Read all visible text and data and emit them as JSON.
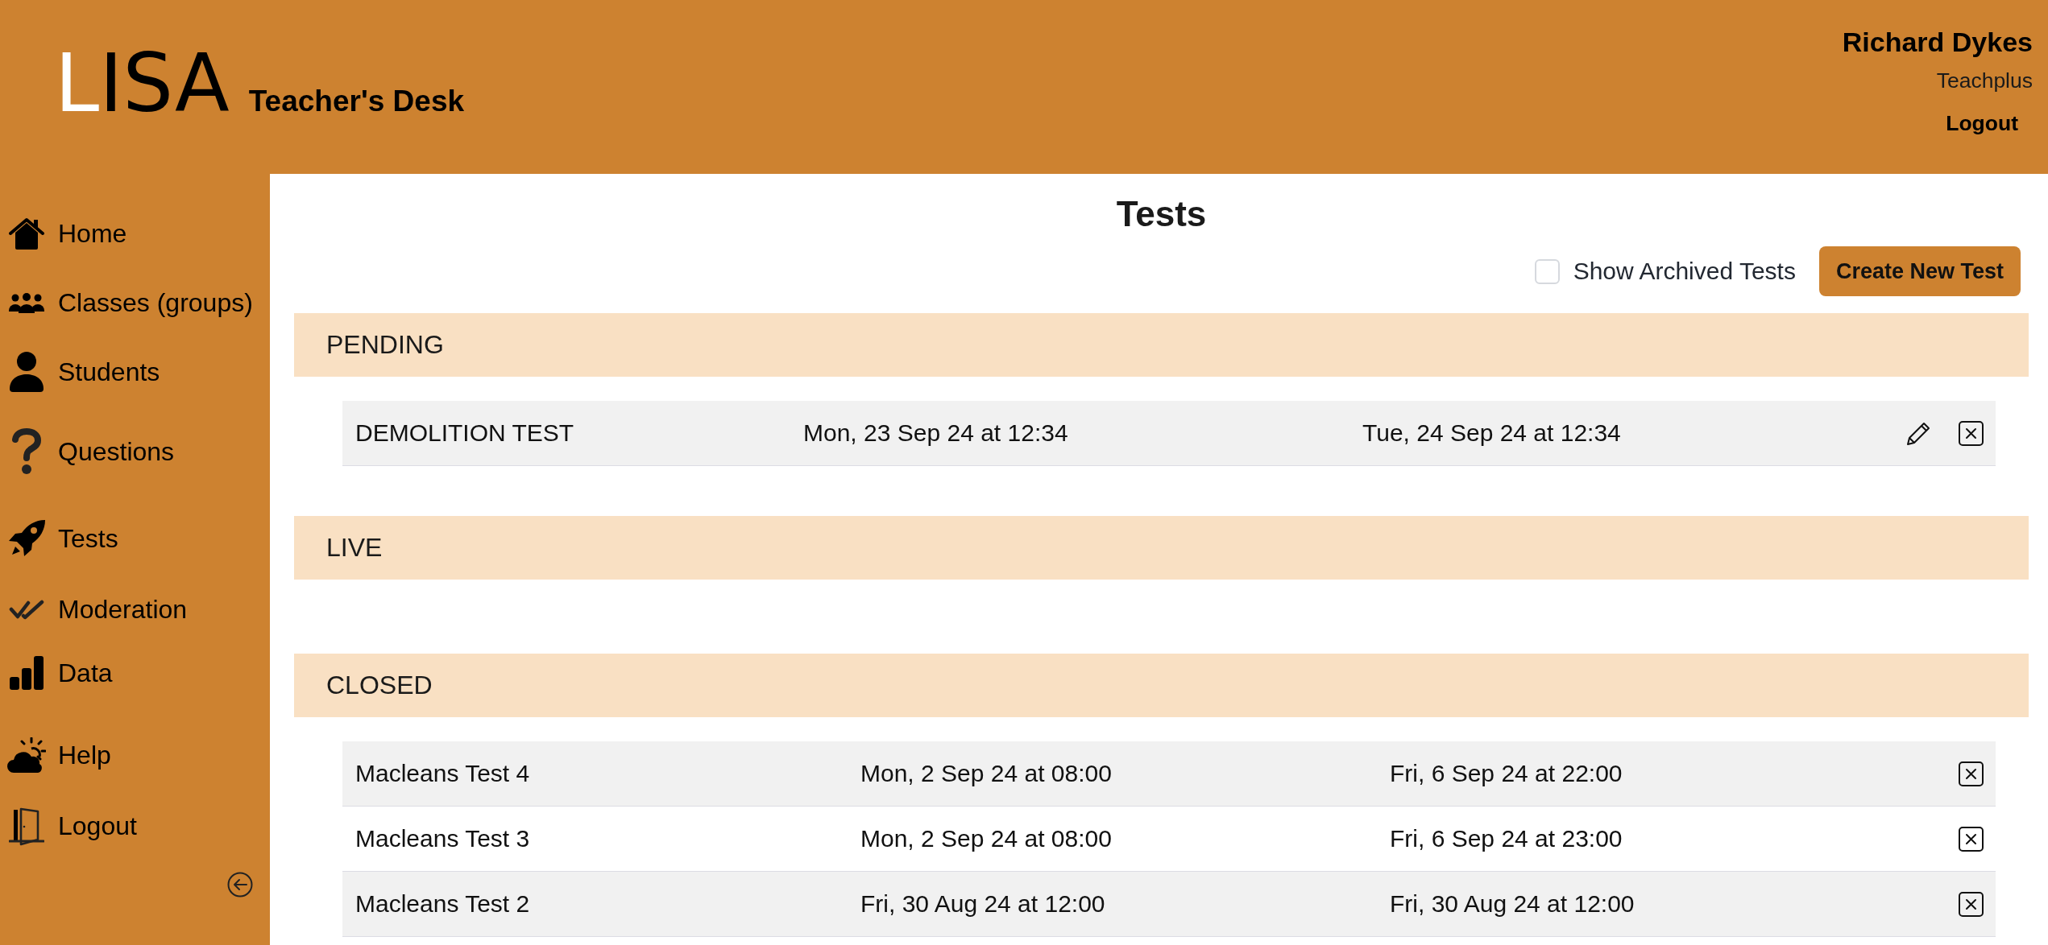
{
  "header": {
    "logo": "LISA",
    "subtitle": "Teacher's Desk",
    "user": {
      "name": "Richard Dykes",
      "organisation": "Teachplus",
      "logout": "Logout"
    }
  },
  "sidebar": {
    "items": [
      {
        "label": "Home"
      },
      {
        "label": "Classes (groups)"
      },
      {
        "label": "Students"
      },
      {
        "label": "Questions"
      },
      {
        "label": "Tests"
      },
      {
        "label": "Moderation"
      },
      {
        "label": "Data"
      },
      {
        "label": "Help"
      },
      {
        "label": "Logout"
      }
    ]
  },
  "page": {
    "title": "Tests",
    "show_archived": {
      "label": "Show Archived Tests",
      "checked": false
    },
    "create_button": "Create New Test"
  },
  "sections": [
    {
      "title": "PENDING",
      "rows": [
        {
          "name": "DEMOLITION TEST",
          "start": "Mon, 23 Sep 24 at 12:34",
          "end": "Tue, 24 Sep 24 at 12:34",
          "editable": true
        }
      ]
    },
    {
      "title": "LIVE"
    },
    {
      "title": "CLOSED",
      "rows": [
        {
          "name": "Macleans Test 4",
          "start": "Mon, 2 Sep 24 at 08:00",
          "end": "Fri, 6 Sep 24 at 22:00",
          "editable": false
        },
        {
          "name": "Macleans Test 3",
          "start": "Mon, 2 Sep 24 at 08:00",
          "end": "Fri, 6 Sep 24 at 23:00",
          "editable": false
        },
        {
          "name": "Macleans Test 2",
          "start": "Fri, 30 Aug 24 at 12:00",
          "end": "Fri, 30 Aug 24 at 12:00",
          "editable": false
        }
      ]
    }
  ]
}
